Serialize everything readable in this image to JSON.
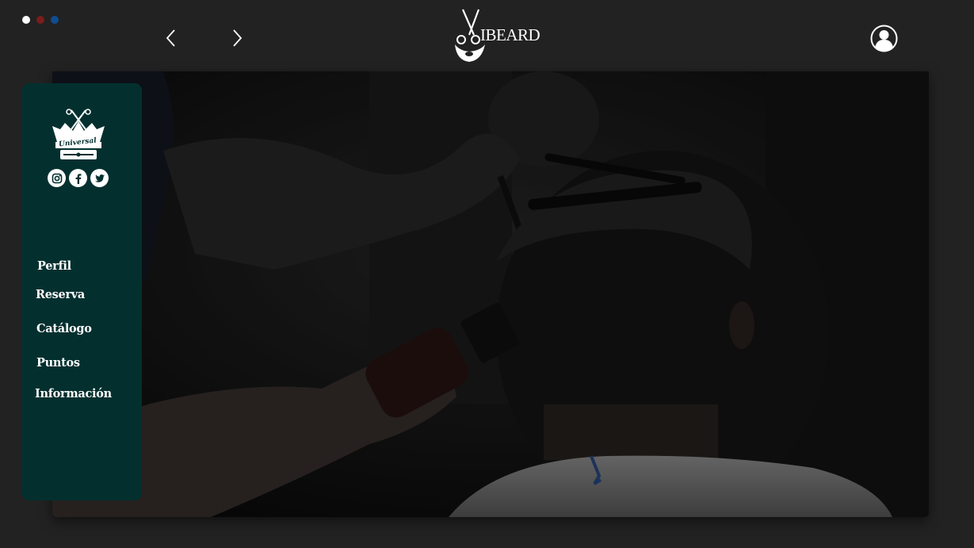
{
  "window_controls": {
    "dots": [
      {
        "name": "close",
        "color": "#ffffff"
      },
      {
        "name": "minimize",
        "color": "#7a1d1d"
      },
      {
        "name": "maximize",
        "color": "#0f4d91"
      }
    ]
  },
  "header": {
    "back_icon": "chevron-left-icon",
    "forward_icon": "chevron-right-icon",
    "brand": "IBEARD",
    "account_icon": "user-avatar-icon"
  },
  "sidebar": {
    "crest_text": "Universal",
    "social": [
      "instagram-icon",
      "facebook-icon",
      "twitter-icon"
    ],
    "menu": [
      {
        "label": "Perfil"
      },
      {
        "label": "Reserva"
      },
      {
        "label": "Catálogo"
      },
      {
        "label": "Puntos"
      },
      {
        "label": "Información"
      }
    ]
  },
  "hero": {
    "content": "barber-haircut-photo"
  },
  "colors": {
    "background": "#222222",
    "sidebar": "#03302f",
    "text": "#ffffff"
  }
}
